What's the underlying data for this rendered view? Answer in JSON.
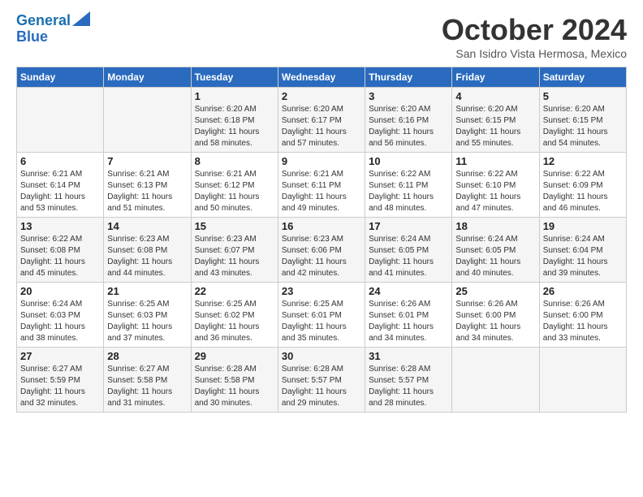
{
  "header": {
    "logo_line1": "General",
    "logo_line2": "Blue",
    "month": "October 2024",
    "location": "San Isidro Vista Hermosa, Mexico"
  },
  "days_of_week": [
    "Sunday",
    "Monday",
    "Tuesday",
    "Wednesday",
    "Thursday",
    "Friday",
    "Saturday"
  ],
  "weeks": [
    [
      {
        "day": "",
        "sunrise": "",
        "sunset": "",
        "daylight": ""
      },
      {
        "day": "",
        "sunrise": "",
        "sunset": "",
        "daylight": ""
      },
      {
        "day": "1",
        "sunrise": "Sunrise: 6:20 AM",
        "sunset": "Sunset: 6:18 PM",
        "daylight": "Daylight: 11 hours and 58 minutes."
      },
      {
        "day": "2",
        "sunrise": "Sunrise: 6:20 AM",
        "sunset": "Sunset: 6:17 PM",
        "daylight": "Daylight: 11 hours and 57 minutes."
      },
      {
        "day": "3",
        "sunrise": "Sunrise: 6:20 AM",
        "sunset": "Sunset: 6:16 PM",
        "daylight": "Daylight: 11 hours and 56 minutes."
      },
      {
        "day": "4",
        "sunrise": "Sunrise: 6:20 AM",
        "sunset": "Sunset: 6:15 PM",
        "daylight": "Daylight: 11 hours and 55 minutes."
      },
      {
        "day": "5",
        "sunrise": "Sunrise: 6:20 AM",
        "sunset": "Sunset: 6:15 PM",
        "daylight": "Daylight: 11 hours and 54 minutes."
      }
    ],
    [
      {
        "day": "6",
        "sunrise": "Sunrise: 6:21 AM",
        "sunset": "Sunset: 6:14 PM",
        "daylight": "Daylight: 11 hours and 53 minutes."
      },
      {
        "day": "7",
        "sunrise": "Sunrise: 6:21 AM",
        "sunset": "Sunset: 6:13 PM",
        "daylight": "Daylight: 11 hours and 51 minutes."
      },
      {
        "day": "8",
        "sunrise": "Sunrise: 6:21 AM",
        "sunset": "Sunset: 6:12 PM",
        "daylight": "Daylight: 11 hours and 50 minutes."
      },
      {
        "day": "9",
        "sunrise": "Sunrise: 6:21 AM",
        "sunset": "Sunset: 6:11 PM",
        "daylight": "Daylight: 11 hours and 49 minutes."
      },
      {
        "day": "10",
        "sunrise": "Sunrise: 6:22 AM",
        "sunset": "Sunset: 6:11 PM",
        "daylight": "Daylight: 11 hours and 48 minutes."
      },
      {
        "day": "11",
        "sunrise": "Sunrise: 6:22 AM",
        "sunset": "Sunset: 6:10 PM",
        "daylight": "Daylight: 11 hours and 47 minutes."
      },
      {
        "day": "12",
        "sunrise": "Sunrise: 6:22 AM",
        "sunset": "Sunset: 6:09 PM",
        "daylight": "Daylight: 11 hours and 46 minutes."
      }
    ],
    [
      {
        "day": "13",
        "sunrise": "Sunrise: 6:22 AM",
        "sunset": "Sunset: 6:08 PM",
        "daylight": "Daylight: 11 hours and 45 minutes."
      },
      {
        "day": "14",
        "sunrise": "Sunrise: 6:23 AM",
        "sunset": "Sunset: 6:08 PM",
        "daylight": "Daylight: 11 hours and 44 minutes."
      },
      {
        "day": "15",
        "sunrise": "Sunrise: 6:23 AM",
        "sunset": "Sunset: 6:07 PM",
        "daylight": "Daylight: 11 hours and 43 minutes."
      },
      {
        "day": "16",
        "sunrise": "Sunrise: 6:23 AM",
        "sunset": "Sunset: 6:06 PM",
        "daylight": "Daylight: 11 hours and 42 minutes."
      },
      {
        "day": "17",
        "sunrise": "Sunrise: 6:24 AM",
        "sunset": "Sunset: 6:05 PM",
        "daylight": "Daylight: 11 hours and 41 minutes."
      },
      {
        "day": "18",
        "sunrise": "Sunrise: 6:24 AM",
        "sunset": "Sunset: 6:05 PM",
        "daylight": "Daylight: 11 hours and 40 minutes."
      },
      {
        "day": "19",
        "sunrise": "Sunrise: 6:24 AM",
        "sunset": "Sunset: 6:04 PM",
        "daylight": "Daylight: 11 hours and 39 minutes."
      }
    ],
    [
      {
        "day": "20",
        "sunrise": "Sunrise: 6:24 AM",
        "sunset": "Sunset: 6:03 PM",
        "daylight": "Daylight: 11 hours and 38 minutes."
      },
      {
        "day": "21",
        "sunrise": "Sunrise: 6:25 AM",
        "sunset": "Sunset: 6:03 PM",
        "daylight": "Daylight: 11 hours and 37 minutes."
      },
      {
        "day": "22",
        "sunrise": "Sunrise: 6:25 AM",
        "sunset": "Sunset: 6:02 PM",
        "daylight": "Daylight: 11 hours and 36 minutes."
      },
      {
        "day": "23",
        "sunrise": "Sunrise: 6:25 AM",
        "sunset": "Sunset: 6:01 PM",
        "daylight": "Daylight: 11 hours and 35 minutes."
      },
      {
        "day": "24",
        "sunrise": "Sunrise: 6:26 AM",
        "sunset": "Sunset: 6:01 PM",
        "daylight": "Daylight: 11 hours and 34 minutes."
      },
      {
        "day": "25",
        "sunrise": "Sunrise: 6:26 AM",
        "sunset": "Sunset: 6:00 PM",
        "daylight": "Daylight: 11 hours and 34 minutes."
      },
      {
        "day": "26",
        "sunrise": "Sunrise: 6:26 AM",
        "sunset": "Sunset: 6:00 PM",
        "daylight": "Daylight: 11 hours and 33 minutes."
      }
    ],
    [
      {
        "day": "27",
        "sunrise": "Sunrise: 6:27 AM",
        "sunset": "Sunset: 5:59 PM",
        "daylight": "Daylight: 11 hours and 32 minutes."
      },
      {
        "day": "28",
        "sunrise": "Sunrise: 6:27 AM",
        "sunset": "Sunset: 5:58 PM",
        "daylight": "Daylight: 11 hours and 31 minutes."
      },
      {
        "day": "29",
        "sunrise": "Sunrise: 6:28 AM",
        "sunset": "Sunset: 5:58 PM",
        "daylight": "Daylight: 11 hours and 30 minutes."
      },
      {
        "day": "30",
        "sunrise": "Sunrise: 6:28 AM",
        "sunset": "Sunset: 5:57 PM",
        "daylight": "Daylight: 11 hours and 29 minutes."
      },
      {
        "day": "31",
        "sunrise": "Sunrise: 6:28 AM",
        "sunset": "Sunset: 5:57 PM",
        "daylight": "Daylight: 11 hours and 28 minutes."
      },
      {
        "day": "",
        "sunrise": "",
        "sunset": "",
        "daylight": ""
      },
      {
        "day": "",
        "sunrise": "",
        "sunset": "",
        "daylight": ""
      }
    ]
  ]
}
